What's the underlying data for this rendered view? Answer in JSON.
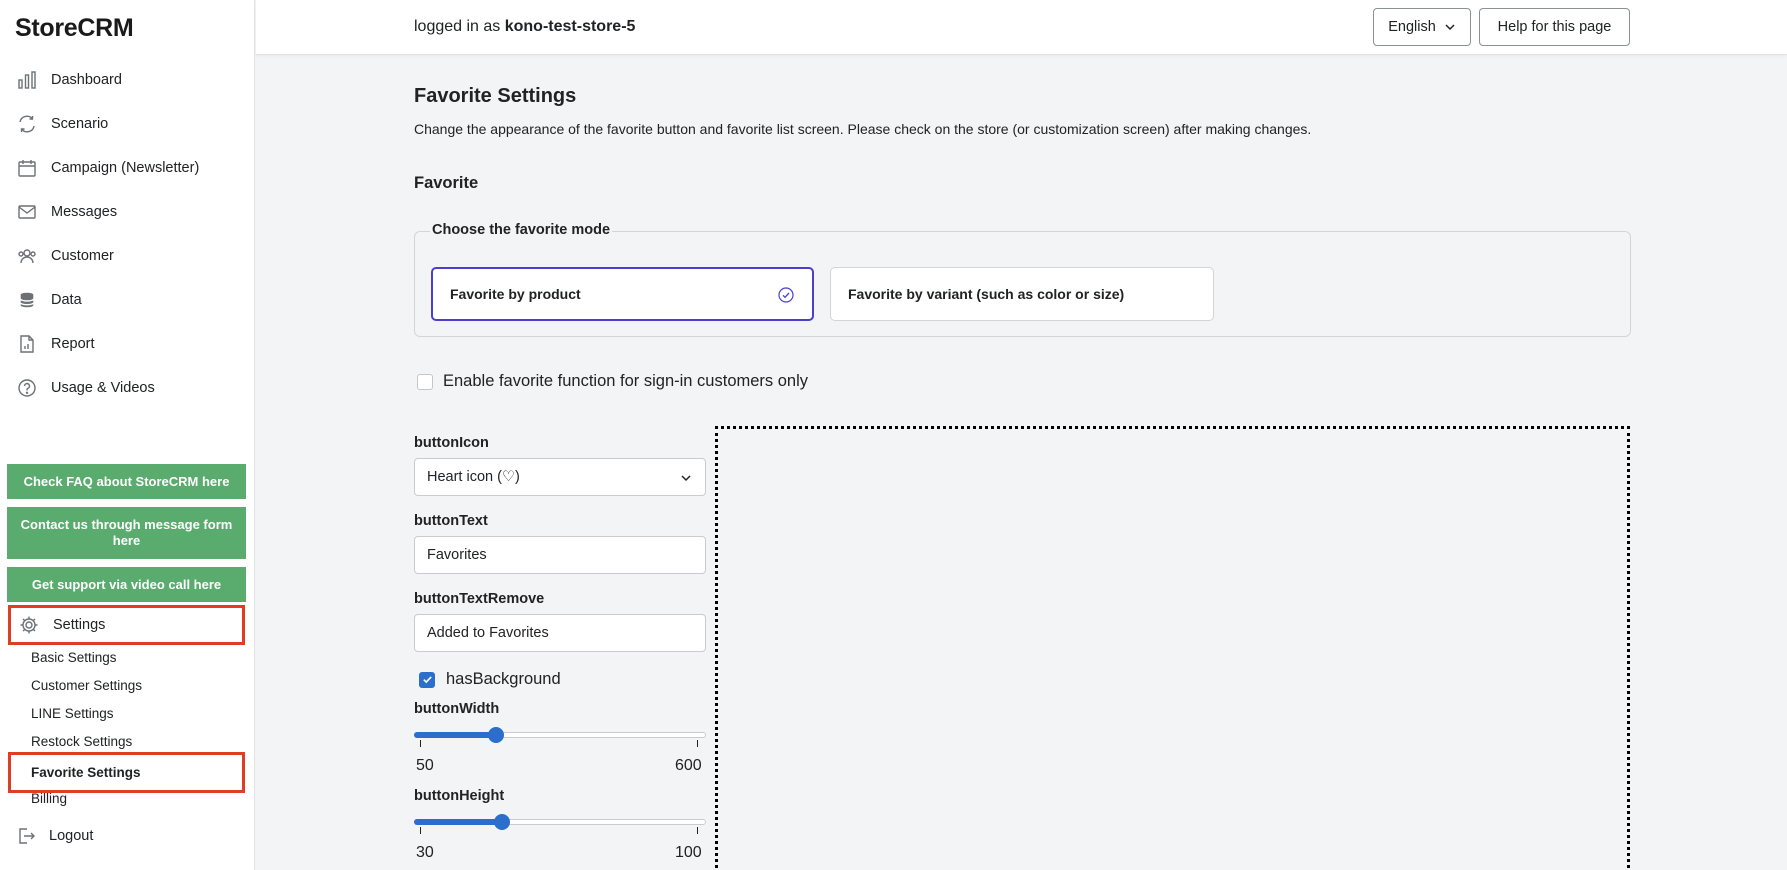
{
  "sidebar": {
    "logo": "StoreCRM",
    "nav": [
      {
        "label": "Dashboard",
        "icon": "bar-chart-icon"
      },
      {
        "label": "Scenario",
        "icon": "refresh-icon"
      },
      {
        "label": "Campaign (Newsletter)",
        "icon": "calendar-icon"
      },
      {
        "label": "Messages",
        "icon": "mail-icon"
      },
      {
        "label": "Customer",
        "icon": "users-icon"
      },
      {
        "label": "Data",
        "icon": "database-icon"
      },
      {
        "label": "Report",
        "icon": "report-icon"
      },
      {
        "label": "Usage & Videos",
        "icon": "question-icon"
      }
    ],
    "faq_button": "Check FAQ about StoreCRM here",
    "contact_button": "Contact us through message form here",
    "video_button": "Get support via video call here",
    "settings_label": "Settings",
    "sub_items": [
      "Basic Settings",
      "Customer Settings",
      "LINE Settings",
      "Restock Settings",
      "Favorite Settings",
      "Billing"
    ],
    "logout_label": "Logout"
  },
  "topbar": {
    "logged_prefix": "logged in as ",
    "store": "kono-test-store-5",
    "language": "English",
    "help": "Help for this page"
  },
  "main": {
    "title": "Favorite Settings",
    "description": "Change the appearance of the favorite button and favorite list screen. Please check on the store (or customization screen) after making changes.",
    "section": "Favorite",
    "mode_legend": "Choose the favorite mode",
    "mode_options": [
      "Favorite by product",
      "Favorite by variant (such as color or size)"
    ],
    "selected_mode": 0,
    "signin_only_label": "Enable favorite function for sign-in customers only",
    "signin_only_checked": false,
    "fields": {
      "button_icon_label": "buttonIcon",
      "button_icon_value": "Heart icon (♡)",
      "button_text_label": "buttonText",
      "button_text_value": "Favorites",
      "button_text_remove_label": "buttonTextRemove",
      "button_text_remove_value": "Added to Favorites",
      "has_background_label": "hasBackground",
      "has_background_checked": true,
      "button_width_label": "buttonWidth",
      "button_width_min": "50",
      "button_width_max": "600",
      "button_width_fraction": 0.28,
      "button_height_label": "buttonHeight",
      "button_height_min": "30",
      "button_height_max": "100",
      "button_height_fraction": 0.3
    }
  },
  "colors": {
    "accent": "#2c6ecb",
    "selected_border": "#4b3fce",
    "green_button": "#5aab6e",
    "highlight": "#e03e24"
  }
}
